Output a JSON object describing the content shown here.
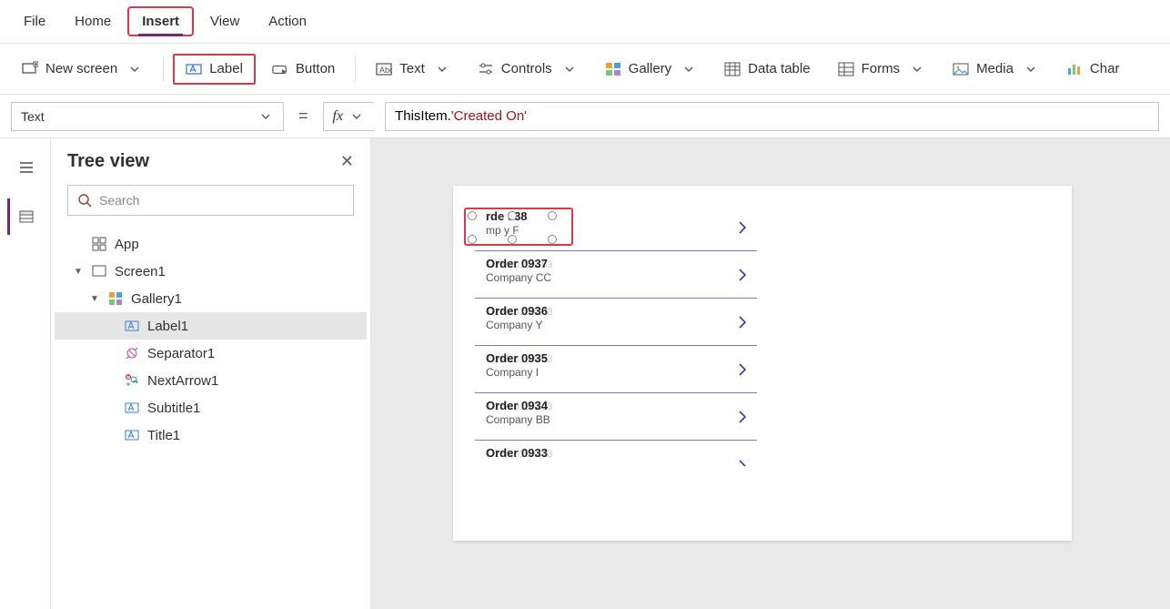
{
  "menu": {
    "file": "File",
    "home": "Home",
    "insert": "Insert",
    "view": "View",
    "action": "Action"
  },
  "ribbon": {
    "new_screen": "New screen",
    "label": "Label",
    "button": "Button",
    "text": "Text",
    "controls": "Controls",
    "gallery": "Gallery",
    "data_table": "Data table",
    "forms": "Forms",
    "media": "Media",
    "chart": "Char"
  },
  "formulabar": {
    "property": "Text",
    "equals": "=",
    "formula_obj": "ThisItem",
    "formula_dot": ".",
    "formula_field": "'Created On'"
  },
  "panel": {
    "title": "Tree view",
    "search_placeholder": "Search",
    "tree": {
      "app": "App",
      "screen": "Screen1",
      "gallery": "Gallery1",
      "label": "Label1",
      "separator": "Separator1",
      "nextarrow": "NextArrow1",
      "subtitle": "Subtitle1",
      "title": "Title1"
    }
  },
  "canvas": {
    "items": [
      {
        "title": "rde   938",
        "date": "",
        "sub": "mp    y F"
      },
      {
        "title": "Order 0937",
        "date": "1/28/2019 9:03",
        "sub": "Company CC"
      },
      {
        "title": "Order 0936",
        "date": "1/28/2019 9:03",
        "sub": "Company Y"
      },
      {
        "title": "Order 0935",
        "date": "1/28/2019 9:03",
        "sub": "Company I"
      },
      {
        "title": "Order 0934",
        "date": "1/28/2019 9:03",
        "sub": "Company BB"
      },
      {
        "title": "Order 0933",
        "date": "1/28/2019 9:03",
        "sub": ""
      }
    ]
  }
}
